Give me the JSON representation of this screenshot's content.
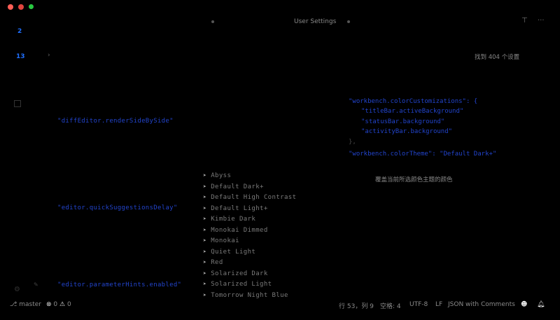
{
  "window": {
    "title": "",
    "traffic_lights": [
      "close",
      "minimize",
      "zoom"
    ]
  },
  "activity_bar": {
    "badges": [
      "2",
      "13"
    ]
  },
  "tab": {
    "label": "User Settings"
  },
  "search_info": "找到 404 个设置",
  "editor": {
    "left_keys": [
      "\"diffEditor.renderSideBySide\"",
      "\"editor.quickSuggestionsDelay\"",
      "\"editor.parameterHints.enabled\""
    ],
    "suggest_items": [
      "Abyss",
      "Default Dark+",
      "Default High Contrast",
      "Default Light+",
      "Kimbie Dark",
      "Monokai Dimmed",
      "Monokai",
      "Quiet Light",
      "Red",
      "Solarized Dark",
      "Solarized Light",
      "Tomorrow Night Blue"
    ],
    "right_lines": [
      "\"workbench.colorCustomizations\": {",
      "\"titleBar.activeBackground\"",
      "\"statusBar.background\"",
      "\"activityBar.background\"",
      "},",
      "\"workbench.colorTheme\": \"Default Dark+\""
    ],
    "hint": "覆盖当前所选颜色主题的颜色"
  },
  "status_bar": {
    "branch": "master",
    "errors": "0",
    "warnings": "0",
    "position": "行 53，列 9",
    "spaces": "空格: 4",
    "encoding": "UTF-8",
    "eol": "LF",
    "language": "JSON with Comments"
  },
  "colors": {
    "background": "#000000",
    "accent_blue": "#2244cc",
    "badge_blue": "#1f6fff"
  }
}
